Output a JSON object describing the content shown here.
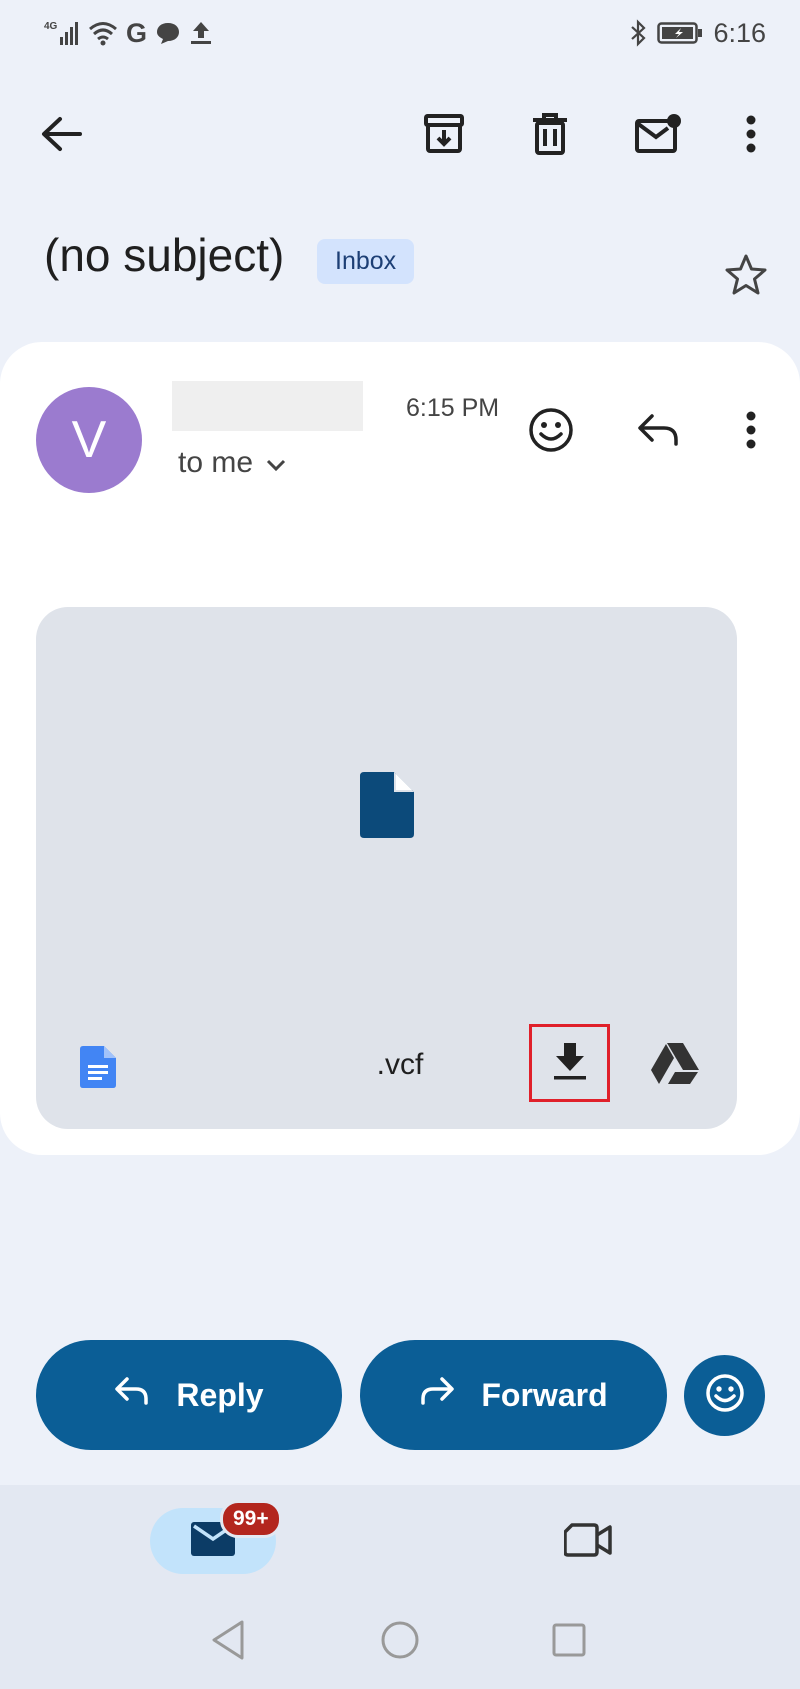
{
  "status_bar": {
    "network_label": "4G",
    "carrier_letter": "G",
    "time": "6:16",
    "icons": [
      "signal-icon",
      "wifi-icon",
      "google-icon",
      "chat-icon",
      "upload-icon",
      "bluetooth-icon",
      "battery-icon"
    ]
  },
  "toolbar": {
    "icons": [
      "back-arrow-icon",
      "archive-icon",
      "delete-icon",
      "mark-unread-icon",
      "more-vert-icon"
    ]
  },
  "email": {
    "subject": "(no subject)",
    "label": "Inbox",
    "sender_initial": "V",
    "time": "6:15 PM",
    "recipients": "to me"
  },
  "attachment": {
    "filename": ".vcf",
    "icons": [
      "file-icon",
      "docs-icon",
      "download-icon",
      "drive-icon"
    ]
  },
  "actions": {
    "reply_label": "Reply",
    "forward_label": "Forward"
  },
  "bottom_nav": {
    "mail_badge": "99+",
    "icons": [
      "mail-icon",
      "video-icon"
    ]
  },
  "colors": {
    "background": "#edf1f9",
    "primary": "#0b5e96",
    "avatar": "#9b7bcf",
    "badge": "#b3261e",
    "highlight": "#e0202a"
  }
}
